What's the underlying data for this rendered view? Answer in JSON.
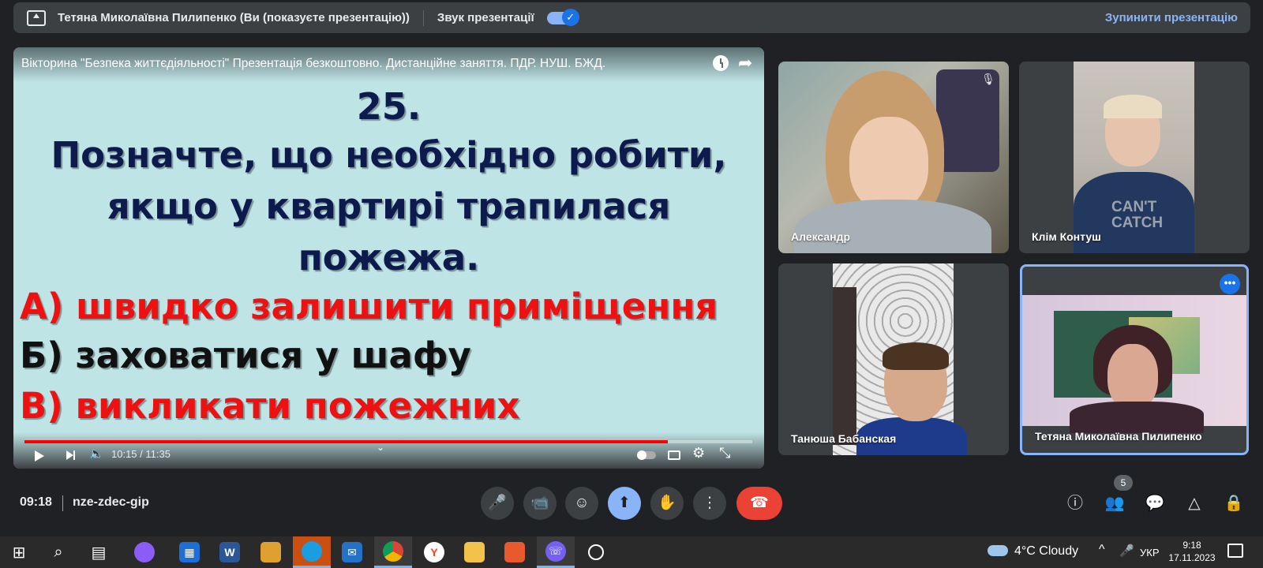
{
  "present_bar": {
    "presenter_text": "Тетяна Миколаївна Пилипенко (Ви (показуєте презентацію))",
    "sound_label": "Звук презентації",
    "stop_label": "Зупинити презентацію"
  },
  "video": {
    "title": "Вікторина \"Безпека життєдіяльності\" Презентація безкоштовно. Дистанційне заняття. ПДР. НУШ. БЖД.",
    "slide": {
      "number": "25.",
      "question_1": "Позначте, що необхідно робити,",
      "question_2": "якщо у квартирі трапилася",
      "question_3": "пожежа.",
      "answer_a": "А) швидко залишити приміщення",
      "answer_b": "Б) заховатися у шафу",
      "answer_c": "В) викликати пожежних"
    },
    "time": "10:15 / 11:35",
    "progress_fraction": 0.884,
    "progress_color": "#ff0000"
  },
  "participants": [
    {
      "name": "Александр",
      "muted": true
    },
    {
      "name": "Клім Контуш",
      "shirt_text": "CAN'T CATCH"
    },
    {
      "name": "Танюша Бабанская"
    },
    {
      "name": "Тетяна Миколаївна Пилипенко",
      "active": true
    }
  ],
  "meeting": {
    "time": "09:18",
    "code": "nze-zdec-gip",
    "people_count": "5",
    "hangup_color": "#ea4335",
    "present_color": "#8ab4f8"
  },
  "taskbar": {
    "weather": "4°C  Cloudy",
    "lang": "УКР",
    "clock_time": "9:18",
    "clock_date": "17.11.2023"
  }
}
